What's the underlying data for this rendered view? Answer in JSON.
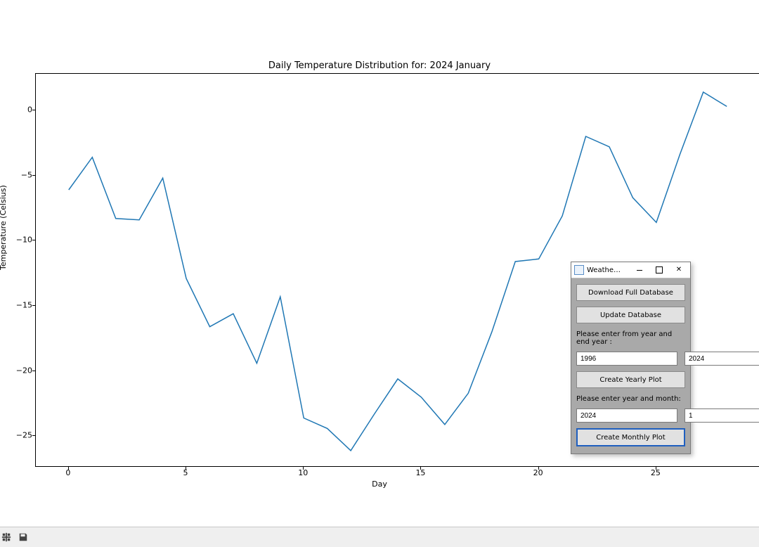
{
  "chart_data": {
    "type": "line",
    "title": "Daily Temperature Distribution for: 2024 January",
    "xlabel": "Day",
    "ylabel": "Temperature (Celsius)",
    "xlim": [
      -1.4,
      29.4
    ],
    "ylim": [
      -27.4,
      2.8
    ],
    "xticks": [
      0,
      5,
      10,
      15,
      20,
      25
    ],
    "yticks": [
      -25,
      -20,
      -15,
      -10,
      -5,
      0
    ],
    "x": [
      0,
      1,
      2,
      3,
      4,
      5,
      6,
      7,
      8,
      9,
      10,
      11,
      12,
      13,
      14,
      15,
      16,
      17,
      18,
      19,
      20,
      21,
      22,
      23,
      24,
      25,
      26,
      27,
      28
    ],
    "y": [
      -6.1,
      -3.6,
      -8.3,
      -8.4,
      -5.2,
      -12.9,
      -16.6,
      -15.6,
      -19.4,
      -14.3,
      -23.6,
      -24.4,
      -26.1,
      -23.3,
      -20.6,
      -22.0,
      -24.1,
      -21.7,
      -17.0,
      -11.6,
      -11.4,
      -8.1,
      -2.0,
      -2.8,
      -6.7,
      -8.6,
      -3.4,
      1.4,
      0.3
    ]
  },
  "dialog": {
    "title": "Weathe…",
    "download_label": "Download Full Database",
    "update_label": "Update Database",
    "range_prompt": "Please enter from year and end year :",
    "year_from": "1996",
    "year_to": "2024",
    "yearly_plot_label": "Create Yearly Plot",
    "month_prompt": "Please enter year and month:",
    "month_year": "2024",
    "month_num": "1",
    "monthly_plot_label": "Create Monthly Plot"
  },
  "toolbar": {
    "configure_name": "configure-subplots-icon",
    "save_name": "save-figure-icon"
  }
}
